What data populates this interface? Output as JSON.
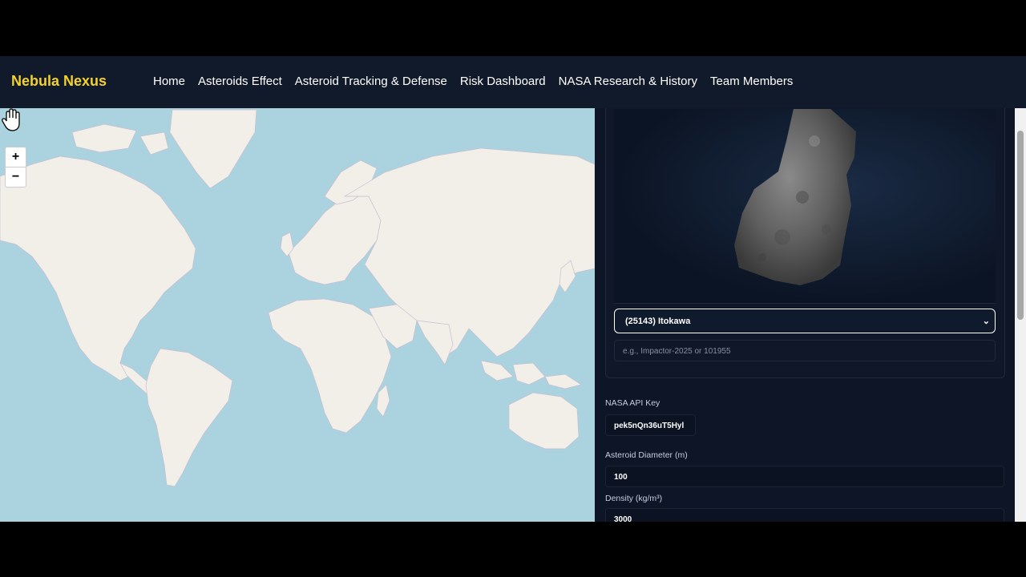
{
  "nav": {
    "brand": "Nebula Nexus",
    "links": [
      "Home",
      "Asteroids Effect",
      "Asteroid Tracking & Defense",
      "Risk Dashboard",
      "NASA Research & History",
      "Team Members"
    ]
  },
  "map": {
    "zoom_in": "+",
    "zoom_out": "−"
  },
  "panel": {
    "asteroid_select": "(25143) Itokawa",
    "search_placeholder": "e.g., Impactor-2025 or 101955",
    "api_key_label": "NASA API Key",
    "api_key_value": "pek5nQn36uT5Hyl",
    "diameter_label": "Asteroid Diameter (m)",
    "diameter_value": "100",
    "density_label": "Density (kg/m³)",
    "density_value": "3000"
  },
  "colors": {
    "brand": "#f5d22a",
    "ocean": "#aad3df",
    "land": "#f2efe9",
    "panel_bg": "#0d1526"
  }
}
